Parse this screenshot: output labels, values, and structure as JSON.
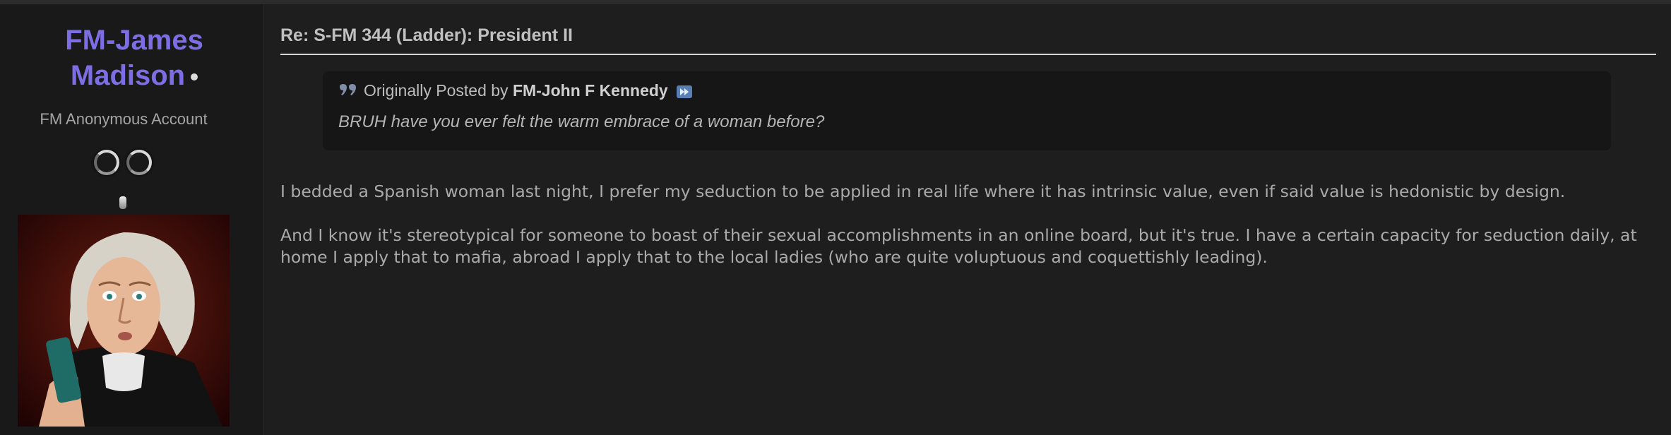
{
  "user": {
    "name_line1": "FM-James",
    "name_line2": "Madison",
    "title": "FM Anonymous Account"
  },
  "post": {
    "title": "Re: S-FM 344 (Ladder): President II",
    "quote": {
      "prefix": "Originally Posted by",
      "author": "FM-John F Kennedy",
      "text": "BRUH have you ever felt the warm embrace of a woman before?"
    },
    "paragraphs": [
      "I bedded a Spanish woman last night, I prefer my seduction to be applied in real life where it has intrinsic value, even if said value is hedonistic by design.",
      "And I know it's stereotypical for someone to boast of their sexual accomplishments in an online board, but it's true. I have a certain capacity for seduction daily, at home I apply that to mafia, abroad I apply that to the local ladies (who are quite voluptuous and coquettishly leading)."
    ]
  },
  "colors": {
    "username": "#7d6ee6",
    "background": "#1e1e1e",
    "sidebar": "#191919",
    "quote_bg": "#161616"
  },
  "icons": [
    "online-status-icon",
    "reputation-icon",
    "quote-icon",
    "view-post-icon"
  ]
}
